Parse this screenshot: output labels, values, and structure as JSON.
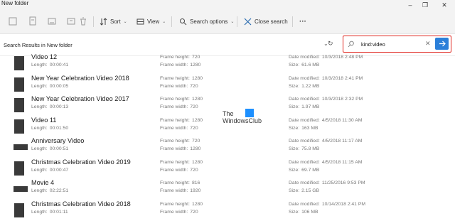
{
  "window": {
    "title": "New folder"
  },
  "toolbar": {
    "sort_label": "Sort",
    "view_label": "View",
    "search_options_label": "Search options",
    "close_search_label": "Close search",
    "more_label": "···"
  },
  "address": {
    "path": "Search Results in New folder"
  },
  "search": {
    "value": "kind:video",
    "accent": "#e0261f",
    "go_color": "#2b7fd9"
  },
  "watermark": {
    "line1": "The",
    "line2": "WindowsClub"
  },
  "files": [
    {
      "name": "Video 12",
      "length_label": "Length:",
      "length": "00:00:41",
      "fh_label": "Frame height:",
      "frame_height": "720",
      "fw_label": "Frame width:",
      "frame_width": "1280",
      "dm_label": "Date modified:",
      "date_modified": "10/3/2018 2:48 PM",
      "size_label": "Size:",
      "size": "61.6 MB",
      "thumb": "portrait"
    },
    {
      "name": "New Year Celebration Video 2018",
      "length_label": "Length:",
      "length": "00:00:05",
      "fh_label": "Frame height:",
      "frame_height": "1280",
      "fw_label": "Frame width:",
      "frame_width": "720",
      "dm_label": "Date modified:",
      "date_modified": "10/3/2018 2:41 PM",
      "size_label": "Size:",
      "size": "1.22 MB",
      "thumb": "portrait"
    },
    {
      "name": "New Year Celebration Video 2017",
      "length_label": "Length:",
      "length": "00:00:13",
      "fh_label": "Frame height:",
      "frame_height": "1280",
      "fw_label": "Frame width:",
      "frame_width": "720",
      "dm_label": "Date modified:",
      "date_modified": "10/3/2018 2:32 PM",
      "size_label": "Size:",
      "size": "1.97 MB",
      "thumb": "portrait"
    },
    {
      "name": "Video 11",
      "length_label": "Length:",
      "length": "00:01:50",
      "fh_label": "Frame height:",
      "frame_height": "1280",
      "fw_label": "Frame width:",
      "frame_width": "720",
      "dm_label": "Date modified:",
      "date_modified": "4/5/2018 11:30 AM",
      "size_label": "Size:",
      "size": "163 MB",
      "thumb": "portrait"
    },
    {
      "name": "Anniversary Video",
      "length_label": "Length:",
      "length": "00:00:51",
      "fh_label": "Frame height:",
      "frame_height": "720",
      "fw_label": "Frame width:",
      "frame_width": "1280",
      "dm_label": "Date modified:",
      "date_modified": "4/5/2018 11:17 AM",
      "size_label": "Size:",
      "size": "75.8 MB",
      "thumb": "wide"
    },
    {
      "name": "Christmas Celebration Video 2019",
      "length_label": "Length:",
      "length": "00:00:47",
      "fh_label": "Frame height:",
      "frame_height": "1280",
      "fw_label": "Frame width:",
      "frame_width": "720",
      "dm_label": "Date modified:",
      "date_modified": "4/5/2018 11:15 AM",
      "size_label": "Size:",
      "size": "69.7 MB",
      "thumb": "portrait"
    },
    {
      "name": "Movie 4",
      "length_label": "Length:",
      "length": "02:22:51",
      "fh_label": "Frame height:",
      "frame_height": "816",
      "fw_label": "Frame width:",
      "frame_width": "1920",
      "dm_label": "Date modified:",
      "date_modified": "11/25/2016 9:53 PM",
      "size_label": "Size:",
      "size": "2.15 GB",
      "thumb": "wide"
    },
    {
      "name": "Christmas Celebration Video 2018",
      "length_label": "Length:",
      "length": "00:01:11",
      "fh_label": "Frame height:",
      "frame_height": "1280",
      "fw_label": "Frame width:",
      "frame_width": "720",
      "dm_label": "Date modified:",
      "date_modified": "10/14/2018 2:41 PM",
      "size_label": "Size:",
      "size": "106 MB",
      "thumb": "portrait"
    }
  ]
}
